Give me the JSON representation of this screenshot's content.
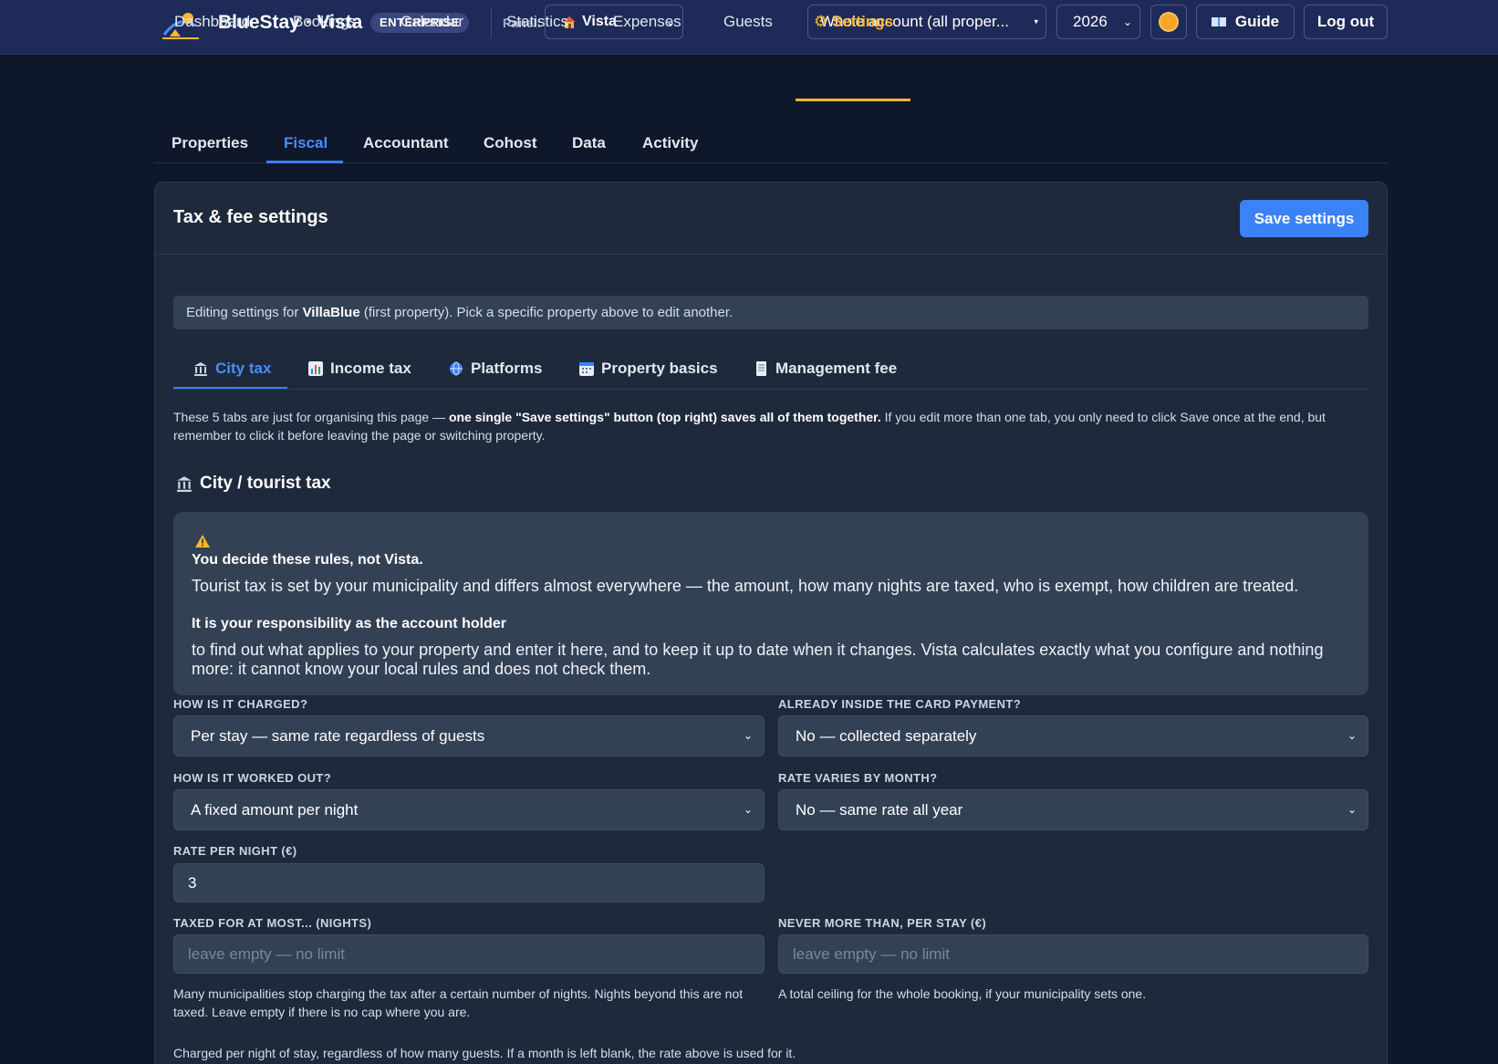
{
  "header": {
    "brand": "BlueStay · Vista",
    "edition_badge": "ENTERPRISE",
    "panel_label": "Panel:",
    "panel_value": "Vista",
    "account_value": "Whole account (all proper...",
    "year_value": "2026",
    "guide_label": "Guide",
    "logout_label": "Log out",
    "accent_color": "#f5b82e"
  },
  "nav": {
    "items": [
      {
        "label": "Dashboard"
      },
      {
        "label": "Bookings"
      },
      {
        "label": "Calendar"
      },
      {
        "label": "Statistics"
      },
      {
        "label": "Expenses"
      },
      {
        "label": "Guests"
      },
      {
        "label": "⚙ Settings",
        "active": true
      }
    ]
  },
  "subtabs": [
    {
      "label": "Properties"
    },
    {
      "label": "Fiscal",
      "active": true
    },
    {
      "label": "Accountant"
    },
    {
      "label": "Cohost"
    },
    {
      "label": "Data"
    },
    {
      "label": "Activity"
    }
  ],
  "card": {
    "title": "Tax & fee settings",
    "save_label": "Save settings",
    "info_prefix": "Editing settings for ",
    "info_property": "VillaBlue",
    "info_suffix": " (first property). Pick a specific property above to edit another."
  },
  "fiscal_tabs": [
    {
      "label": "City tax",
      "icon": "bank-icon",
      "active": true
    },
    {
      "label": "Income tax",
      "icon": "chart-icon"
    },
    {
      "label": "Platforms",
      "icon": "globe-icon"
    },
    {
      "label": "Property basics",
      "icon": "calendar-icon"
    },
    {
      "label": "Management fee",
      "icon": "receipt-icon"
    }
  ],
  "tabs_note": {
    "pre": "These 5 tabs are just for organising this page — ",
    "bold": "one single \"Save settings\" button (top right) saves all of them together.",
    "post": " If you edit more than one tab, you only need to click Save once at the end, but remember to click it before leaving the page or switching property."
  },
  "section": {
    "title": "City / tourist tax"
  },
  "warning": {
    "heading": "You decide these rules, not Vista.",
    "text1": "Tourist tax is set by your municipality and differs almost everywhere — the amount, how many nights are taxed, who is exempt, how children are treated.",
    "heading2": "It is your responsibility as the account holder",
    "text2": "to find out what applies to your property and enter it here, and to keep it up to date when it changes. Vista calculates exactly what you configure and nothing more: it cannot know your local rules and does not check them."
  },
  "form": {
    "charged_label": "HOW IS IT CHARGED?",
    "charged_value": "Per stay — same rate regardless of guests",
    "card_label": "ALREADY INSIDE THE CARD PAYMENT?",
    "card_value": "No — collected separately",
    "worked_label": "HOW IS IT WORKED OUT?",
    "worked_value": "A fixed amount per night",
    "month_label": "RATE VARIES BY MONTH?",
    "month_value": "No — same rate all year",
    "rate_label": "RATE PER NIGHT (€)",
    "rate_value": "3",
    "max_nights_label": "TAXED FOR AT MOST... (NIGHTS)",
    "max_nights_placeholder": "leave empty — no limit",
    "max_stay_label": "NEVER MORE THAN, PER STAY (€)",
    "max_stay_placeholder": "leave empty — no limit",
    "max_nights_help": "Many municipalities stop charging the tax after a certain number of nights. Nights beyond this are not taxed. Leave empty if there is no cap where you are.",
    "max_stay_help": "A total ceiling for the whole booking, if your municipality sets one.",
    "footer_note": "Charged per night of stay, regardless of how many guests. If a month is left blank, the rate above is used for it."
  }
}
